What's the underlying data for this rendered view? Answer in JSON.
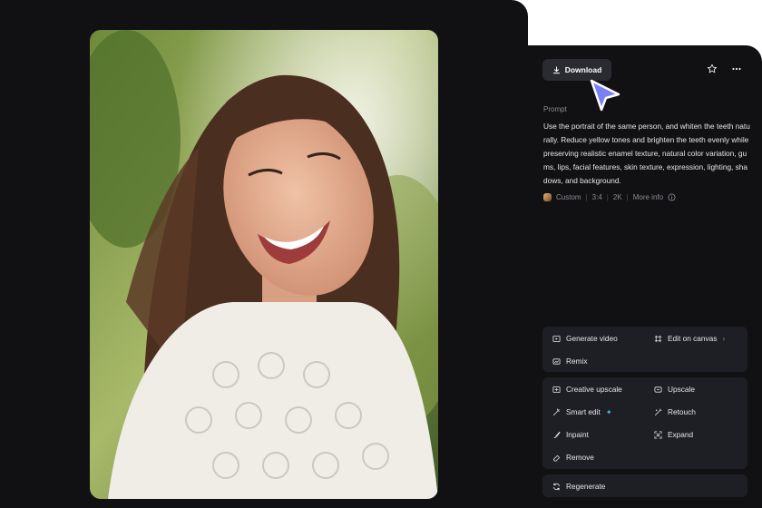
{
  "toolbar": {
    "download_label": "Download"
  },
  "prompt": {
    "label": "Prompt",
    "text": "Use the portrait of the same person, and whiten the teeth naturally. Reduce yellow tones and brighten the teeth evenly while preserving realistic enamel texture, natural color variation, gums, lips, facial features, skin texture, expression, lighting, shadows, and background."
  },
  "meta": {
    "model": "Custom",
    "ratio": "3:4",
    "resolution": "2K",
    "more_info": "More info"
  },
  "actions": {
    "generate_video": "Generate video",
    "edit_on_canvas": "Edit on canvas",
    "remix": "Remix",
    "creative_upscale": "Creative upscale",
    "upscale": "Upscale",
    "smart_edit": "Smart edit",
    "retouch": "Retouch",
    "inpaint": "Inpaint",
    "expand": "Expand",
    "remove": "Remove",
    "regenerate": "Regenerate"
  },
  "colors": {
    "panel": "#111114",
    "card": "#1e1f24",
    "accent_cursor": "#7b7ff5",
    "sparkle": "#3ec0ff"
  }
}
